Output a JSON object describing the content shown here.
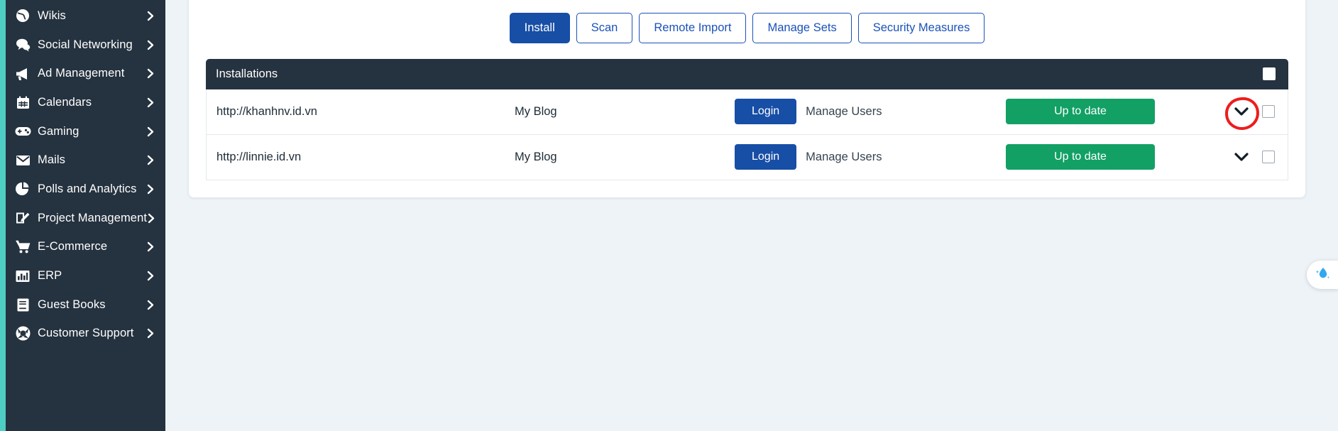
{
  "sidebar": {
    "items": [
      {
        "label": "Wikis",
        "icon": "wiki-globe-icon"
      },
      {
        "label": "Social Networking",
        "icon": "chat-bubbles-icon"
      },
      {
        "label": "Ad Management",
        "icon": "megaphone-icon"
      },
      {
        "label": "Calendars",
        "icon": "calendar-icon"
      },
      {
        "label": "Gaming",
        "icon": "gamepad-icon"
      },
      {
        "label": "Mails",
        "icon": "envelope-icon"
      },
      {
        "label": "Polls and Analytics",
        "icon": "pie-chart-icon"
      },
      {
        "label": "Project Management",
        "icon": "edit-square-icon"
      },
      {
        "label": "E-Commerce",
        "icon": "shopping-cart-icon"
      },
      {
        "label": "ERP",
        "icon": "bar-chart-icon"
      },
      {
        "label": "Guest Books",
        "icon": "book-icon"
      },
      {
        "label": "Customer Support",
        "icon": "lifebuoy-icon"
      }
    ]
  },
  "toolbar": {
    "buttons": [
      {
        "label": "Install",
        "active": true
      },
      {
        "label": "Scan",
        "active": false
      },
      {
        "label": "Remote Import",
        "active": false
      },
      {
        "label": "Manage Sets",
        "active": false
      },
      {
        "label": "Security Measures",
        "active": false
      }
    ]
  },
  "table": {
    "header_title": "Installations",
    "rows": [
      {
        "url": "http://khanhnv.id.vn",
        "name": "My Blog",
        "login_label": "Login",
        "manage_users_label": "Manage Users",
        "status_label": "Up to date",
        "annotated": true
      },
      {
        "url": "http://linnie.id.vn",
        "name": "My Blog",
        "login_label": "Login",
        "manage_users_label": "Manage Users",
        "status_label": "Up to date",
        "annotated": false
      }
    ]
  },
  "float_widget": {
    "icon": "water-droplet-icon"
  },
  "colors": {
    "sidebar_bg": "#25323f",
    "accent_strip": "#4ecdc4",
    "primary_blue": "#174ea6",
    "outline_blue": "#1a52b8",
    "status_green": "#12a065",
    "page_bg": "#eef3f7",
    "annotation_red": "#ee1c1c",
    "droplet_blue": "#33a8ef"
  }
}
